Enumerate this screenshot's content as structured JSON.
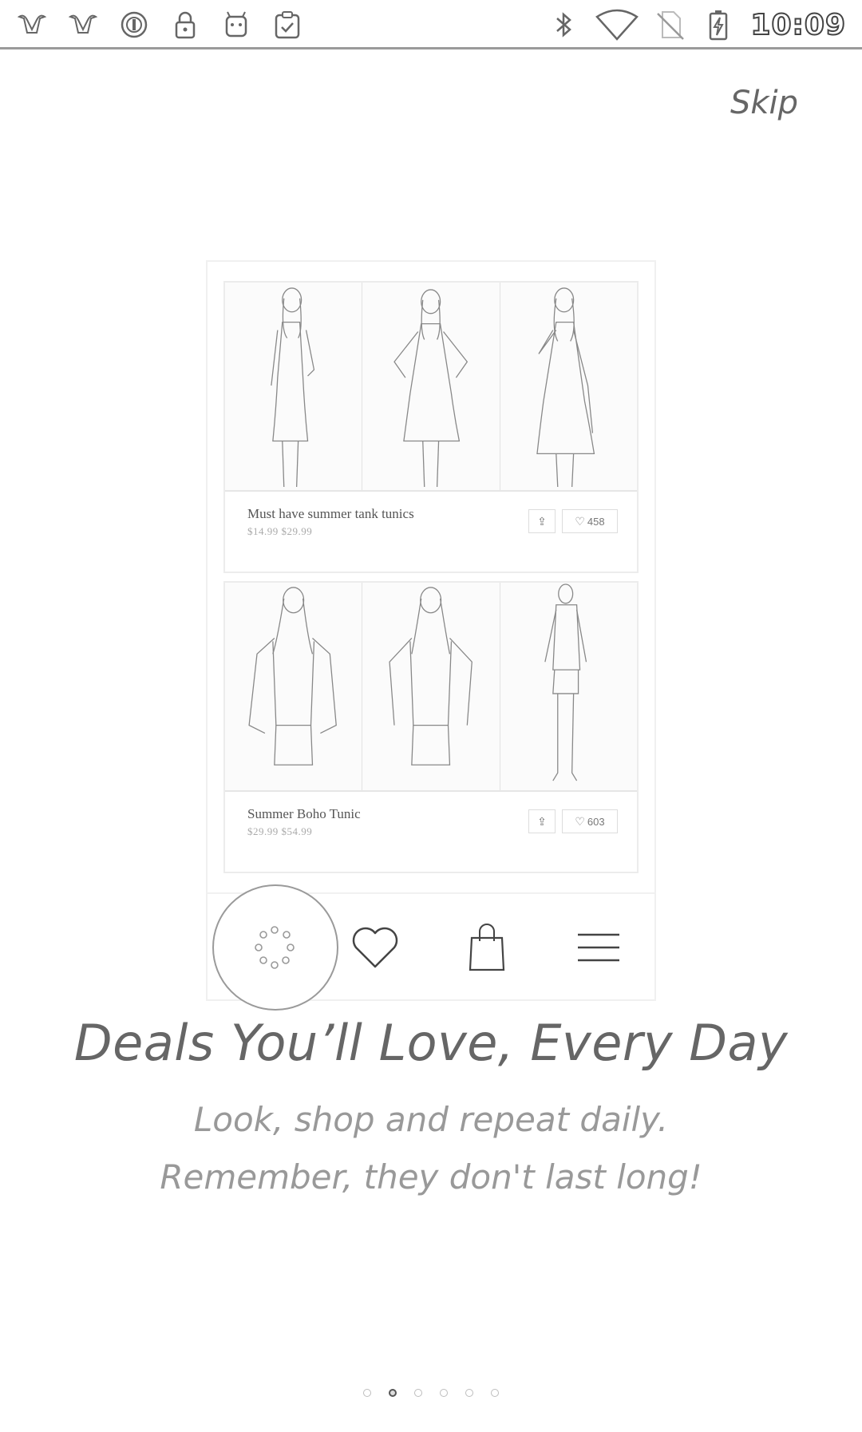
{
  "status_bar": {
    "time": "10:09",
    "left_icons": [
      "notification-icon",
      "notification-icon",
      "circle-icon",
      "lock-icon",
      "android-icon",
      "clipboard-check-icon"
    ],
    "right_icons": [
      "bluetooth-icon",
      "wifi-icon",
      "no-sim-icon",
      "battery-charging-icon"
    ]
  },
  "skip_label": "Skip",
  "mockup": {
    "cards": [
      {
        "title": "Must have summer tank tunics",
        "price": "$14.99",
        "original_price": "$29.99",
        "likes": "458"
      },
      {
        "title": "Summer Boho Tunic",
        "price": "$29.99",
        "original_price": "$54.99",
        "likes": "603"
      }
    ],
    "tabs": [
      "deals-icon",
      "heart-icon",
      "shopping-bag-icon",
      "menu-icon"
    ]
  },
  "headline": "Deals You’ll Love, Every Day",
  "subtitle_line1": "Look, shop and repeat daily.",
  "subtitle_line2": "Remember, they don't last long!",
  "pager": {
    "count": 6,
    "active_index": 1
  }
}
